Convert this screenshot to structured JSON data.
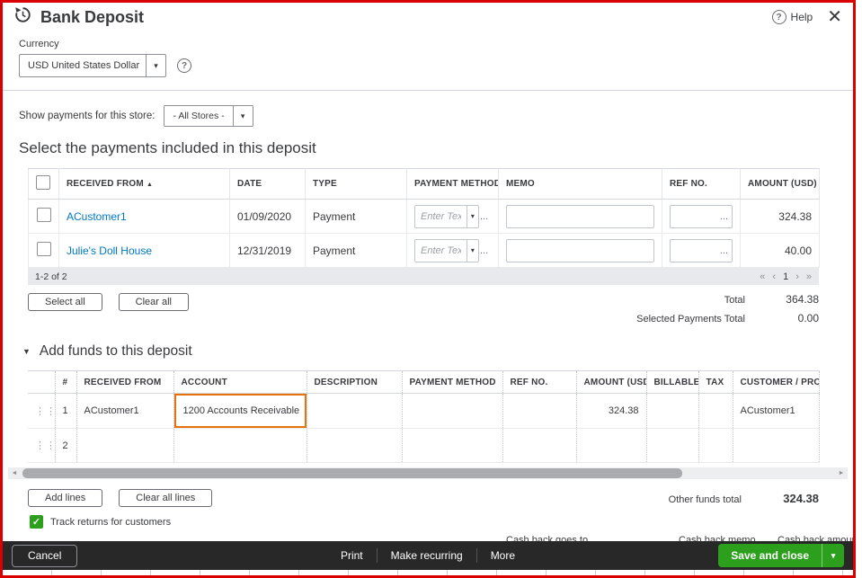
{
  "colors": {
    "brand_green": "#2CA01C",
    "link_blue": "#0077C5",
    "highlight_orange": "#E8730C",
    "frame_red": "#DB0000",
    "footer_dark": "#282828"
  },
  "icons": {
    "question": "?",
    "close": "✕",
    "caret_down": "▾",
    "sort_asc": "▲",
    "section_caret": "▼",
    "check": "✓",
    "overflow_dots": "...",
    "page_first": "«",
    "page_prev": "‹",
    "page_next": "›",
    "page_last": "»",
    "scroll_left": "◄",
    "scroll_right": "►",
    "drag_handle": "⋮⋮"
  },
  "header": {
    "title": "Bank Deposit",
    "help_label": "Help"
  },
  "currency": {
    "label": "Currency",
    "value": "USD United States Dollar"
  },
  "store_filter": {
    "label": "Show payments for this store:",
    "value": "- All Stores -"
  },
  "payments": {
    "heading": "Select the payments included in this deposit",
    "col_received_from": "RECEIVED FROM",
    "col_date": "DATE",
    "col_type": "TYPE",
    "col_payment_method": "PAYMENT METHOD",
    "col_memo": "MEMO",
    "col_ref_no": "REF NO.",
    "col_amount": "AMOUNT (USD)",
    "enter_text_placeholder": "Enter Text",
    "rows": [
      {
        "received_from": "ACustomer1",
        "date": "01/09/2020",
        "type": "Payment",
        "memo": "",
        "ref_no": "",
        "amount": "324.38"
      },
      {
        "received_from": "Julie's Doll House",
        "date": "12/31/2019",
        "type": "Payment",
        "memo": "",
        "ref_no": "",
        "amount": "40.00"
      }
    ],
    "pagination_range": "1-2 of 2",
    "page_number": "1",
    "select_all_label": "Select all",
    "clear_all_label": "Clear all",
    "total_label": "Total",
    "total_value": "364.38",
    "selected_total_label": "Selected Payments Total",
    "selected_total_value": "0.00"
  },
  "funds": {
    "heading": "Add funds to this deposit",
    "col_num": "#",
    "col_received_from": "RECEIVED FROM",
    "col_account": "ACCOUNT",
    "col_description": "DESCRIPTION",
    "col_payment_method": "PAYMENT METHOD",
    "col_ref_no": "REF NO.",
    "col_amount": "AMOUNT (USD)",
    "col_billable": "BILLABLE",
    "col_tax": "TAX",
    "col_customer": "CUSTOMER / PROJECT",
    "rows": [
      {
        "num": "1",
        "received_from": "ACustomer1",
        "account": "1200 Accounts Receivable",
        "description": "",
        "payment_method": "",
        "ref_no": "",
        "amount": "324.38",
        "billable": "",
        "tax": "",
        "customer": "ACustomer1"
      },
      {
        "num": "2",
        "received_from": "",
        "account": "",
        "description": "",
        "payment_method": "",
        "ref_no": "",
        "amount": "",
        "billable": "",
        "tax": "",
        "customer": ""
      }
    ],
    "add_lines_label": "Add lines",
    "clear_all_lines_label": "Clear all lines",
    "other_funds_total_label": "Other funds total",
    "other_funds_total_value": "324.38",
    "track_returns_label": "Track returns for customers"
  },
  "cashback": {
    "goes_to_label": "Cash back goes to",
    "memo_label": "Cash back memo",
    "amount_label": "Cash back amount"
  },
  "footer": {
    "cancel_label": "Cancel",
    "print_label": "Print",
    "make_recurring_label": "Make recurring",
    "more_label": "More",
    "save_label": "Save and close"
  }
}
